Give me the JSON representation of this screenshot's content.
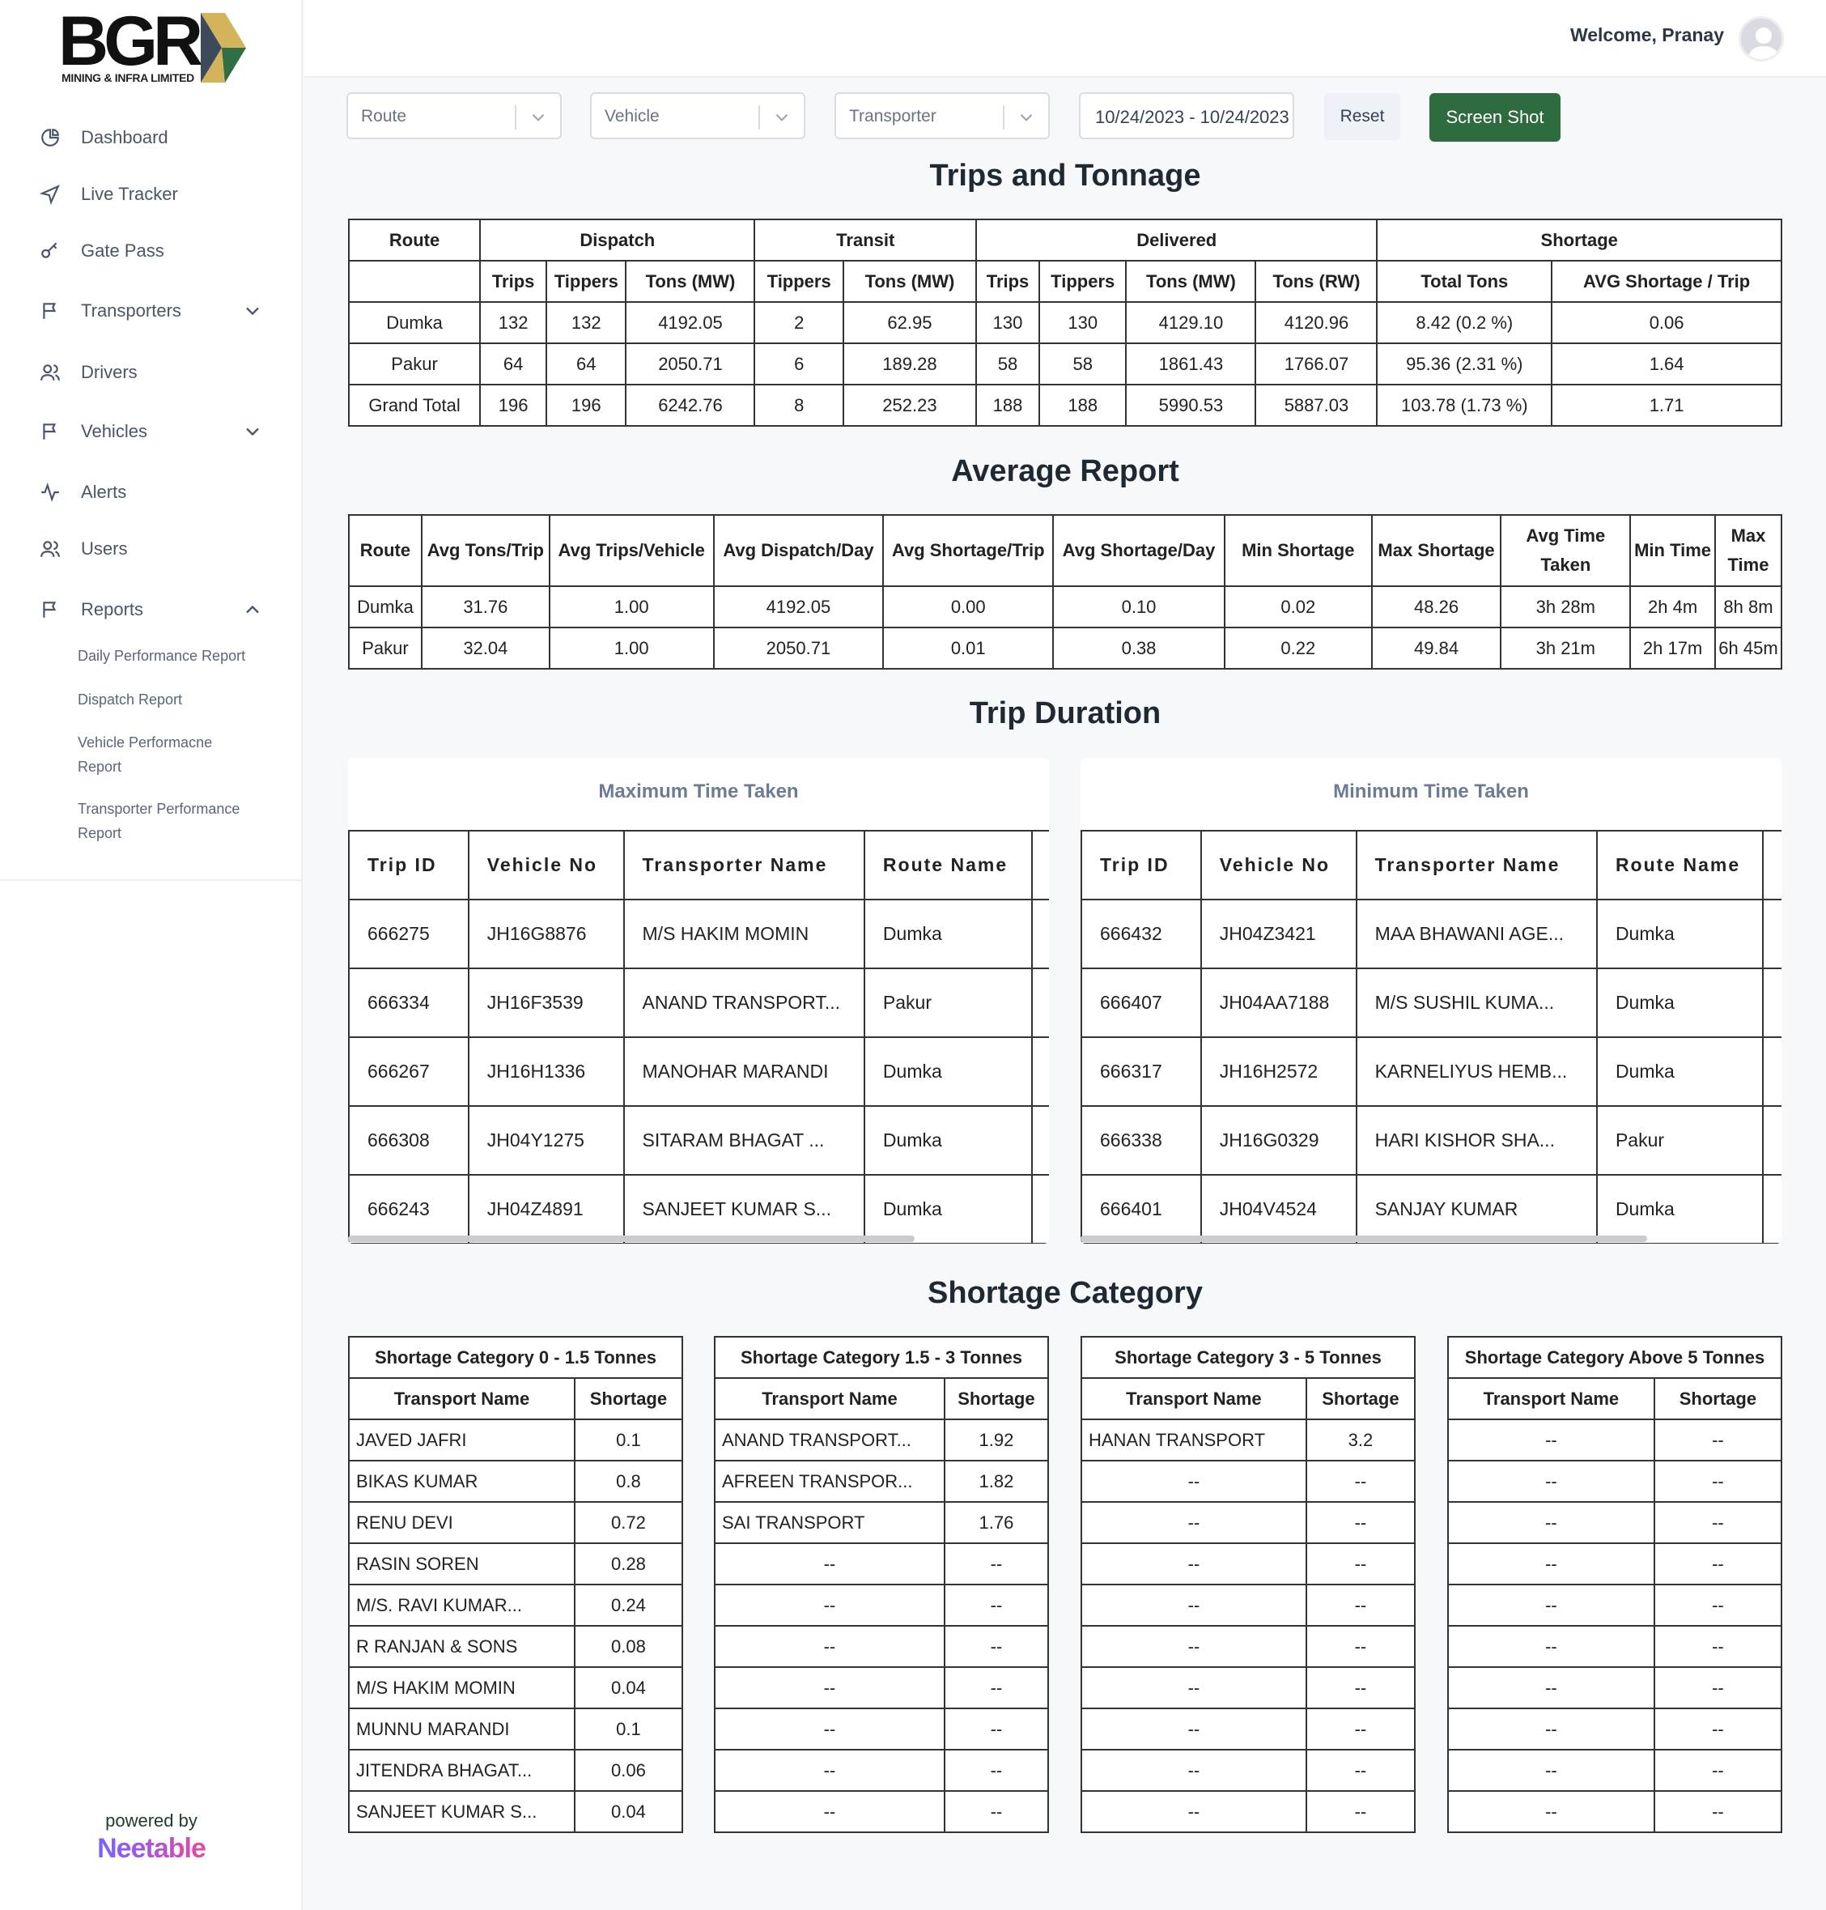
{
  "brand": {
    "logo_text": "BGR",
    "logo_subtitle": "MINING & INFRA LIMITED",
    "powered_by": "powered by",
    "vendor": "Neetable"
  },
  "header": {
    "welcome": "Welcome, Pranay"
  },
  "sidebar": {
    "items": [
      {
        "label": "Dashboard",
        "icon": "pie-chart-icon"
      },
      {
        "label": "Live Tracker",
        "icon": "navigation-icon"
      },
      {
        "label": "Gate Pass",
        "icon": "key-icon"
      },
      {
        "label": "Transporters",
        "icon": "flag-icon",
        "expandable": true
      },
      {
        "label": "Drivers",
        "icon": "users-icon"
      },
      {
        "label": "Vehicles",
        "icon": "flag-icon",
        "expandable": true
      },
      {
        "label": "Alerts",
        "icon": "activity-icon"
      },
      {
        "label": "Users",
        "icon": "users-icon"
      },
      {
        "label": "Reports",
        "icon": "flag-icon",
        "expanded": true
      }
    ],
    "report_links": [
      "Daily Performance Report",
      "Dispatch Report",
      "Vehicle Performacne Report",
      "Transporter Performance Report"
    ]
  },
  "filters": {
    "route_placeholder": "Route",
    "vehicle_placeholder": "Vehicle",
    "transporter_placeholder": "Transporter",
    "date_range": "10/24/2023 - 10/24/2023",
    "reset_label": "Reset",
    "screenshot_label": "Screen Shot"
  },
  "trips_tonnage": {
    "title": "Trips and Tonnage",
    "groups": [
      "Route",
      "Dispatch",
      "Transit",
      "Delivered",
      "Shortage"
    ],
    "columns": [
      "Trips",
      "Tippers",
      "Tons (MW)",
      "Tippers",
      "Tons (MW)",
      "Trips",
      "Tippers",
      "Tons (MW)",
      "Tons (RW)",
      "Total Tons",
      "AVG Shortage / Trip"
    ],
    "rows": [
      [
        "Dumka",
        "132",
        "132",
        "4192.05",
        "2",
        "62.95",
        "130",
        "130",
        "4129.10",
        "4120.96",
        "8.42 (0.2 %)",
        "0.06"
      ],
      [
        "Pakur",
        "64",
        "64",
        "2050.71",
        "6",
        "189.28",
        "58",
        "58",
        "1861.43",
        "1766.07",
        "95.36 (2.31 %)",
        "1.64"
      ],
      [
        "Grand Total",
        "196",
        "196",
        "6242.76",
        "8",
        "252.23",
        "188",
        "188",
        "5990.53",
        "5887.03",
        "103.78 (1.73 %)",
        "1.71"
      ]
    ]
  },
  "average_report": {
    "title": "Average Report",
    "columns": [
      "Route",
      "Avg Tons/Trip",
      "Avg Trips/Vehicle",
      "Avg Dispatch/Day",
      "Avg Shortage/Trip",
      "Avg Shortage/Day",
      "Min Shortage",
      "Max Shortage",
      "Avg Time Taken",
      "Min Time",
      "Max Time"
    ],
    "rows": [
      [
        "Dumka",
        "31.76",
        "1.00",
        "4192.05",
        "0.00",
        "0.10",
        "0.02",
        "48.26",
        "3h 28m",
        "2h 4m",
        "8h 8m"
      ],
      [
        "Pakur",
        "32.04",
        "1.00",
        "2050.71",
        "0.01",
        "0.38",
        "0.22",
        "49.84",
        "3h 21m",
        "2h 17m",
        "6h 45m"
      ]
    ]
  },
  "trip_duration": {
    "title": "Trip Duration",
    "columns": [
      "Trip ID",
      "Vehicle No",
      "Transporter Name",
      "Route Name"
    ],
    "max": {
      "title": "Maximum Time Taken",
      "rows": [
        [
          "666275",
          "JH16G8876",
          "M/S HAKIM MOMIN",
          "Dumka"
        ],
        [
          "666334",
          "JH16F3539",
          "ANAND TRANSPORT...",
          "Pakur"
        ],
        [
          "666267",
          "JH16H1336",
          "MANOHAR MARANDI",
          "Dumka"
        ],
        [
          "666308",
          "JH04Y1275",
          "SITARAM BHAGAT ...",
          "Dumka"
        ],
        [
          "666243",
          "JH04Z4891",
          "SANJEET KUMAR S...",
          "Dumka"
        ]
      ]
    },
    "min": {
      "title": "Minimum Time Taken",
      "rows": [
        [
          "666432",
          "JH04Z3421",
          "MAA BHAWANI AGE...",
          "Dumka"
        ],
        [
          "666407",
          "JH04AA7188",
          "M/S SUSHIL KUMA...",
          "Dumka"
        ],
        [
          "666317",
          "JH16H2572",
          "KARNELIYUS HEMB...",
          "Dumka"
        ],
        [
          "666338",
          "JH16G0329",
          "HARI KISHOR SHA...",
          "Pakur"
        ],
        [
          "666401",
          "JH04V4524",
          "SANJAY KUMAR",
          "Dumka"
        ]
      ]
    }
  },
  "shortage_category": {
    "title": "Shortage Category",
    "col_name": "Transport Name",
    "col_value": "Shortage",
    "tables": [
      {
        "title": "Shortage Category 0 - 1.5 Tonnes",
        "rows": [
          [
            "JAVED JAFRI",
            "0.1"
          ],
          [
            "BIKAS KUMAR",
            "0.8"
          ],
          [
            "RENU DEVI",
            "0.72"
          ],
          [
            "RASIN SOREN",
            "0.28"
          ],
          [
            "M/S. RAVI KUMAR...",
            "0.24"
          ],
          [
            "R RANJAN & SONS",
            "0.08"
          ],
          [
            "M/S HAKIM MOMIN",
            "0.04"
          ],
          [
            "MUNNU MARANDI",
            "0.1"
          ],
          [
            "JITENDRA BHAGAT...",
            "0.06"
          ],
          [
            "SANJEET KUMAR S...",
            "0.04"
          ]
        ]
      },
      {
        "title": "Shortage Category 1.5 - 3 Tonnes",
        "rows": [
          [
            "ANAND TRANSPORT...",
            "1.92"
          ],
          [
            "AFREEN TRANSPOR...",
            "1.82"
          ],
          [
            "SAI TRANSPORT",
            "1.76"
          ],
          [
            "--",
            "--"
          ],
          [
            "--",
            "--"
          ],
          [
            "--",
            "--"
          ],
          [
            "--",
            "--"
          ],
          [
            "--",
            "--"
          ],
          [
            "--",
            "--"
          ],
          [
            "--",
            "--"
          ]
        ]
      },
      {
        "title": "Shortage Category 3 - 5 Tonnes",
        "rows": [
          [
            "HANAN TRANSPORT",
            "3.2"
          ],
          [
            "--",
            "--"
          ],
          [
            "--",
            "--"
          ],
          [
            "--",
            "--"
          ],
          [
            "--",
            "--"
          ],
          [
            "--",
            "--"
          ],
          [
            "--",
            "--"
          ],
          [
            "--",
            "--"
          ],
          [
            "--",
            "--"
          ],
          [
            "--",
            "--"
          ]
        ]
      },
      {
        "title": "Shortage Category Above 5 Tonnes",
        "rows": [
          [
            "--",
            "--"
          ],
          [
            "--",
            "--"
          ],
          [
            "--",
            "--"
          ],
          [
            "--",
            "--"
          ],
          [
            "--",
            "--"
          ],
          [
            "--",
            "--"
          ],
          [
            "--",
            "--"
          ],
          [
            "--",
            "--"
          ],
          [
            "--",
            "--"
          ],
          [
            "--",
            "--"
          ]
        ]
      }
    ]
  }
}
